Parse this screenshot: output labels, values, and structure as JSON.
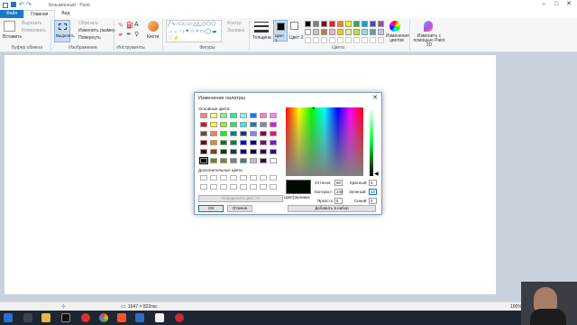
{
  "window": {
    "title": "Безымянный - Paint"
  },
  "tabs": [
    {
      "label": "Файл"
    },
    {
      "label": "Главная"
    },
    {
      "label": "Вид"
    }
  ],
  "ribbon": {
    "clipboard": {
      "paste_label": "Вставить",
      "cut_label": "Вырезать",
      "copy_label": "Копировать",
      "group_label": "Буфер обмена"
    },
    "image": {
      "select_label": "Выделить",
      "crop_label": "Обрезать",
      "resize_label": "Изменить размер",
      "rotate_label": "Повернуть",
      "group_label": "Изображение"
    },
    "tools": {
      "group_label": "Инструменты",
      "brushes_label": "Кисти"
    },
    "shapes": {
      "outline_label": "Контур",
      "fill_label": "Заливка",
      "group_label": "Фигуры"
    },
    "size_label": "Толщина",
    "color1_label": "Цвет 1",
    "color2_label": "Цвет 2",
    "colors_group_label": "Цвета",
    "edit_colors_label": "Изменение цветов",
    "paint3d_label": "Изменить с помощью Paint 3D",
    "palette": [
      "#000000",
      "#7f7f7f",
      "#880015",
      "#ed1c24",
      "#ff7f27",
      "#fff200",
      "#22b14c",
      "#00a2e8",
      "#3f48cc",
      "#a349a4",
      "#ffffff",
      "#c3c3c3",
      "#b97a57",
      "#ffaec9",
      "#ffc90e",
      "#efe4b0",
      "#b5e61d",
      "#99d9ea",
      "#7092be",
      "#c8bfe7"
    ]
  },
  "statusbar": {
    "dimensions": "1647 × 822пкс",
    "zoom": "100%"
  },
  "dialog": {
    "title": "Изменение палитры",
    "basic_colors_label": "Основные цвета:",
    "custom_colors_label": "Дополнительные цвета:",
    "define_button": "Определить цвет >>",
    "ok_button": "ОК",
    "cancel_button": "Отмена",
    "color_solid_label": "Цвет|Заливка",
    "hue_label": "Оттенок:",
    "hue_value": "80",
    "sat_label": "Контраст:",
    "sat_value": "240",
    "lum_label": "Яркость:",
    "lum_value": "5",
    "red_label": "Красный:",
    "red_value": "0",
    "green_label": "Зеленый:",
    "green_value": "10",
    "blue_label": "Синий:",
    "blue_value": "0",
    "add_button": "Добавить в набор",
    "current_color": "#000a00",
    "basic_colors": [
      "#ff8080",
      "#ffff80",
      "#80ff80",
      "#00ff80",
      "#80ffff",
      "#0080ff",
      "#ff80c0",
      "#ff80ff",
      "#ff0000",
      "#ffff00",
      "#80ff00",
      "#00ff40",
      "#00ffff",
      "#0080c0",
      "#8080c0",
      "#ff00ff",
      "#804040",
      "#ff8040",
      "#00ff00",
      "#008080",
      "#004080",
      "#8080ff",
      "#800040",
      "#ff0080",
      "#800000",
      "#ff8000",
      "#008000",
      "#008040",
      "#0000ff",
      "#0000a0",
      "#800080",
      "#8000ff",
      "#400000",
      "#804000",
      "#004000",
      "#004040",
      "#000080",
      "#000040",
      "#400040",
      "#400080",
      "#000000",
      "#808000",
      "#808040",
      "#808080",
      "#408080",
      "#c0c0c0",
      "#400040",
      "#ffffff"
    ]
  }
}
